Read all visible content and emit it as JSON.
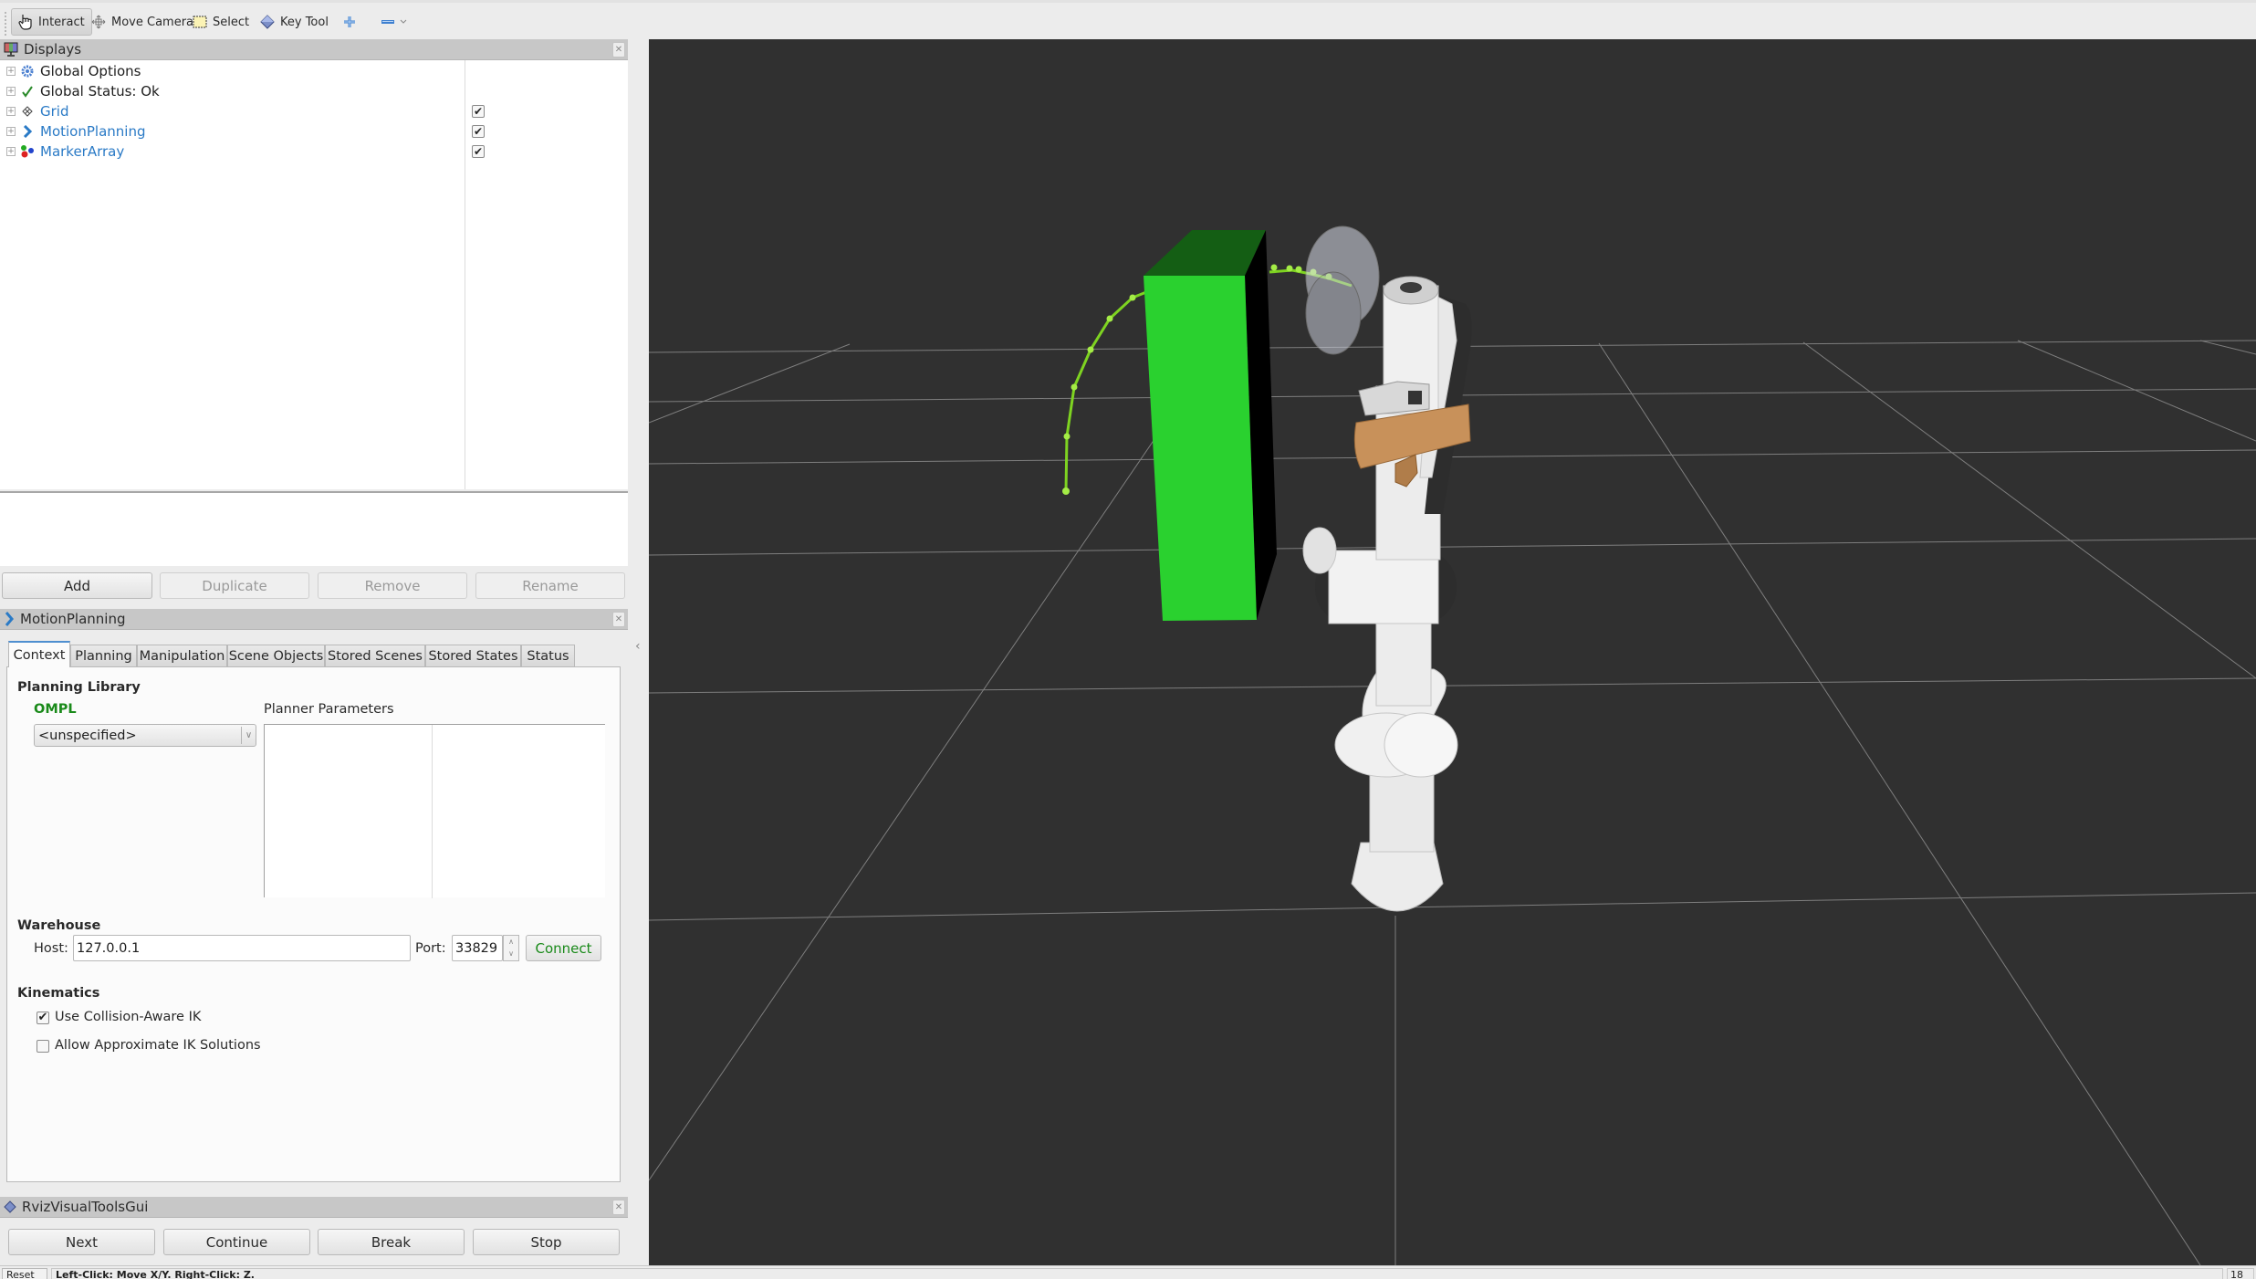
{
  "toolbar": {
    "tools": [
      {
        "label": "Interact",
        "icon": "hand-pointer-icon",
        "active": true
      },
      {
        "label": "Move Camera",
        "icon": "move-camera-icon",
        "active": false
      },
      {
        "label": "Select",
        "icon": "select-rect-icon",
        "active": false
      },
      {
        "label": "Key Tool",
        "icon": "diamond-icon",
        "active": false
      }
    ],
    "add_tool_icon": "plus-icon",
    "remove_tool_icon": "minus-icon",
    "dropdown_icon": "chevron-down-icon"
  },
  "displays": {
    "title": "Displays",
    "items": [
      {
        "label": "Global Options",
        "icon": "gear-icon",
        "checked": null,
        "style": "normal"
      },
      {
        "label": "Global Status: Ok",
        "icon": "checkmark-icon",
        "checked": null,
        "style": "normal"
      },
      {
        "label": "Grid",
        "icon": "grid-icon",
        "checked": true,
        "style": "blue"
      },
      {
        "label": "MotionPlanning",
        "icon": "motion-planning-icon",
        "checked": true,
        "style": "blue"
      },
      {
        "label": "MarkerArray",
        "icon": "marker-array-icon",
        "checked": true,
        "style": "blue"
      }
    ],
    "buttons": {
      "add": "Add",
      "duplicate": "Duplicate",
      "remove": "Remove",
      "rename": "Rename"
    }
  },
  "motion_planning": {
    "title": "MotionPlanning",
    "tabs": [
      "Context",
      "Planning",
      "Manipulation",
      "Scene Objects",
      "Stored Scenes",
      "Stored States",
      "Status"
    ],
    "active_tab": "Context",
    "context": {
      "planning_library_label": "Planning Library",
      "library_name": "OMPL",
      "planner_combo_value": "<unspecified>",
      "planner_parameters_label": "Planner Parameters",
      "warehouse_label": "Warehouse",
      "host_label": "Host:",
      "host_value": "127.0.0.1",
      "port_label": "Port:",
      "port_value": "33829",
      "connect_label": "Connect",
      "kinematics_label": "Kinematics",
      "use_collision_aware_ik": {
        "label": "Use Collision-Aware IK",
        "checked": true
      },
      "allow_approx_ik": {
        "label": "Allow Approximate IK Solutions",
        "checked": false
      }
    }
  },
  "rviz_visual_tools": {
    "title": "RvizVisualToolsGui",
    "buttons": [
      "Next",
      "Continue",
      "Break",
      "Stop"
    ]
  },
  "statusbar": {
    "reset_label": "Reset",
    "hint": "Left-Click: Move X/Y. Right-Click: Z.",
    "fps": "18"
  },
  "colors": {
    "viewport_bg": "#303030",
    "grid_line": "#a0a0a0",
    "collision_box": "#2ad12f",
    "trajectory": "#7ed321",
    "gripper": "#c8915a",
    "robot": "#e8e8e8",
    "link_blue": "#2a7ac6",
    "ompl_green": "#1a8a1a"
  }
}
